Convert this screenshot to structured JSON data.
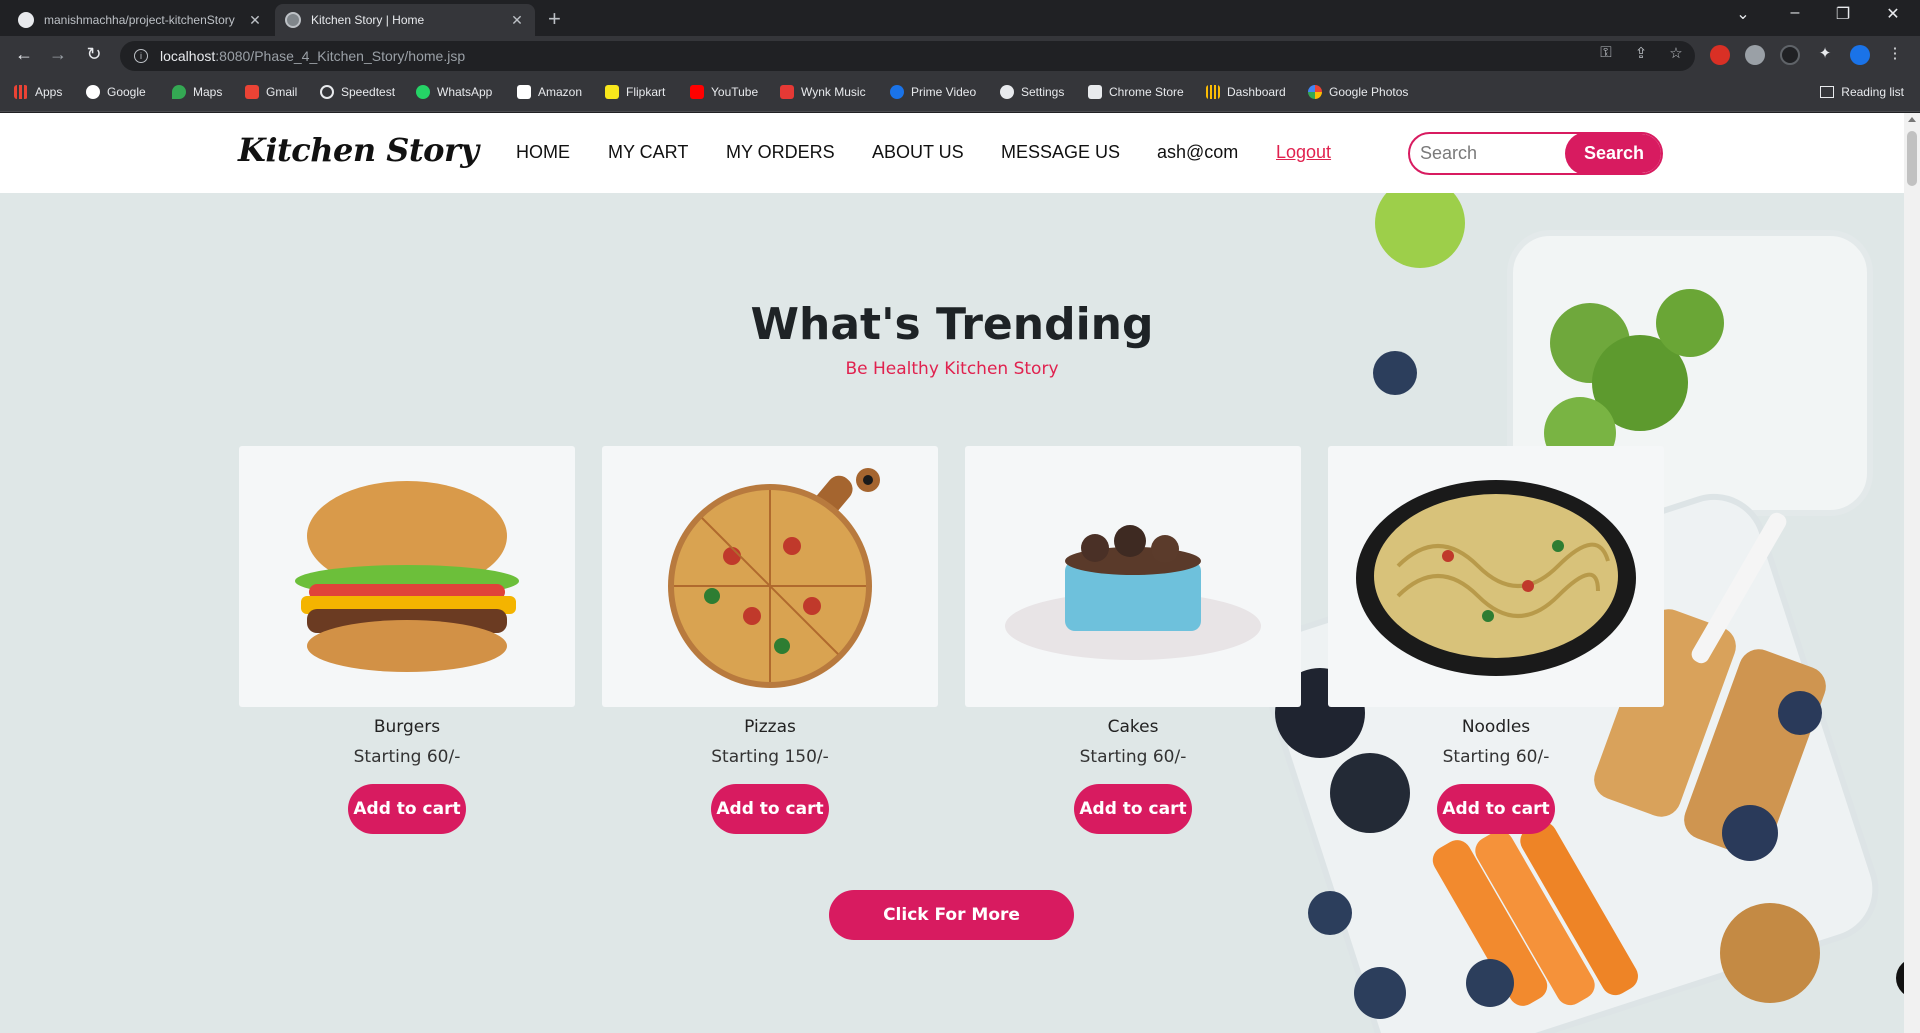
{
  "browser": {
    "tabs": [
      {
        "title": "manishmachha/project-kitchenStory",
        "active": false
      },
      {
        "title": "Kitchen Story | Home",
        "active": true
      }
    ],
    "url_host": "localhost",
    "url_rest": ":8080/Phase_4_Kitchen_Story/home.jsp",
    "bookmarks": [
      "Apps",
      "Google",
      "Maps",
      "Gmail",
      "Speedtest",
      "WhatsApp",
      "Amazon",
      "Flipkart",
      "YouTube",
      "Wynk Music",
      "Prime Video",
      "Settings",
      "Chrome Store",
      "Dashboard",
      "Google Photos"
    ],
    "reading_list": "Reading list"
  },
  "site": {
    "logo": "Kitchen Story",
    "nav": [
      "HOME",
      "MY CART",
      "MY ORDERS",
      "ABOUT US",
      "MESSAGE US",
      "ash@com",
      "Logout"
    ],
    "search_placeholder": "Search",
    "search_button": "Search"
  },
  "main": {
    "heading": "What's Trending",
    "subheading": "Be Healthy Kitchen Story",
    "products": [
      {
        "name": "Burgers",
        "price": "Starting 60/-",
        "button": "Add to cart"
      },
      {
        "name": "Pizzas",
        "price": "Starting 150/-",
        "button": "Add to cart"
      },
      {
        "name": "Cakes",
        "price": "Starting 60/-",
        "button": "Add to cart"
      },
      {
        "name": "Noodles",
        "price": "Starting 60/-",
        "button": "Add to cart"
      }
    ],
    "more_button": "Click For More"
  },
  "colors": {
    "accent": "#d81b60",
    "heading": "#1e2326",
    "subheading": "#e0224f",
    "page_bg": "#dfe7e7"
  }
}
